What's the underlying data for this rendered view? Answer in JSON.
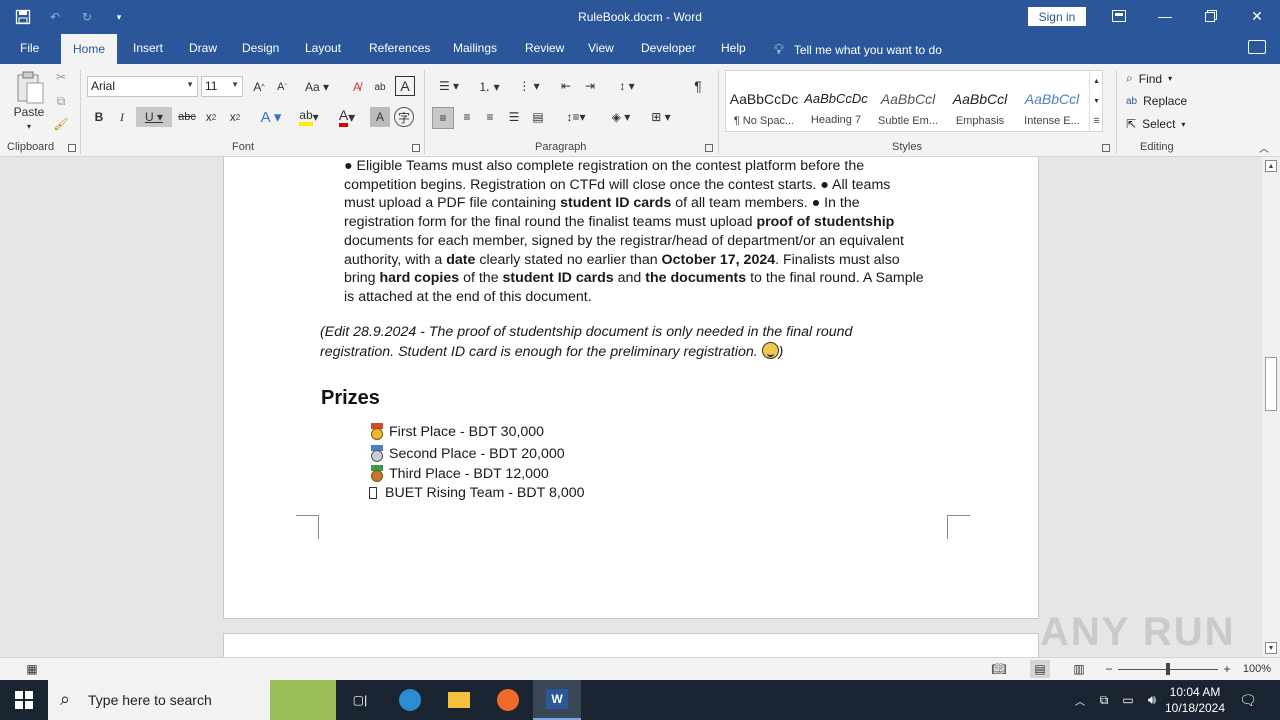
{
  "window": {
    "title": "RuleBook.docm - Word",
    "sign_in": "Sign in"
  },
  "tabs": [
    "File",
    "Home",
    "Insert",
    "Draw",
    "Design",
    "Layout",
    "References",
    "Mailings",
    "Review",
    "View",
    "Developer",
    "Help"
  ],
  "tell_me": "Tell me what you want to do",
  "ribbon": {
    "clipboard": {
      "paste": "Paste",
      "label": "Clipboard"
    },
    "font": {
      "name": "Arial",
      "size": "11",
      "label": "Font"
    },
    "paragraph": {
      "label": "Paragraph"
    },
    "styles": {
      "label": "Styles",
      "items": [
        {
          "preview": "AaBbCcDc",
          "name": "¶ No Spac..."
        },
        {
          "preview": "AaBbCcDc",
          "name": "Heading 7"
        },
        {
          "preview": "AaBbCcl",
          "name": "Subtle Em..."
        },
        {
          "preview": "AaBbCcl",
          "name": "Emphasis"
        },
        {
          "preview": "AaBbCcl",
          "name": "Intense E..."
        }
      ]
    },
    "editing": {
      "find": "Find",
      "replace": "Replace",
      "select": "Select",
      "label": "Editing"
    }
  },
  "document": {
    "bullet_text_lines": [
      "● Eligible Teams must also complete registration on the contest platform before the",
      "competition begins. Registration on CTFd will close once the contest starts. ● All teams"
    ],
    "line3": {
      "a": "must upload a PDF file containing ",
      "b": "student ID cards",
      "c": " of all team members. ● In the"
    },
    "line4": {
      "a": "registration form for the final round the finalist teams must upload ",
      "b": "proof of studentship"
    },
    "line5": "documents for each member, signed by the registrar/head of department/or an equivalent",
    "line6": {
      "a": "authority, with a ",
      "b": "date",
      "c": " clearly stated no earlier than ",
      "d": "October 17, 2024",
      "e": ". Finalists must also"
    },
    "line7": {
      "a": "bring ",
      "b": "hard copies",
      "c": " of the ",
      "d": "student ID cards",
      "e": " and ",
      "f": "the documents",
      "g": " to the final round. A Sample"
    },
    "line8": "is attached at the end of this document.",
    "note_line1": "(Edit 28.9.2024 - The proof of studentship document is only needed in the final round",
    "note_line2": "registration. Student ID card is enough for the preliminary registration.",
    "note_end": ")",
    "heading": "Prizes",
    "prizes": [
      "First Place - BDT 30,000",
      "Second Place - BDT 20,000",
      "Third Place - BDT 12,000",
      "BUET Rising Team - BDT 8,000"
    ]
  },
  "status": {
    "zoom": "100%"
  },
  "taskbar": {
    "search_placeholder": "Type here to search",
    "time": "10:04 AM",
    "date": "10/18/2024"
  },
  "watermark": "ANY RUN",
  "colors": {
    "word_blue": "#2b579a",
    "ribbon_bg": "#f3f3f3",
    "taskbar": "#1a2330"
  }
}
